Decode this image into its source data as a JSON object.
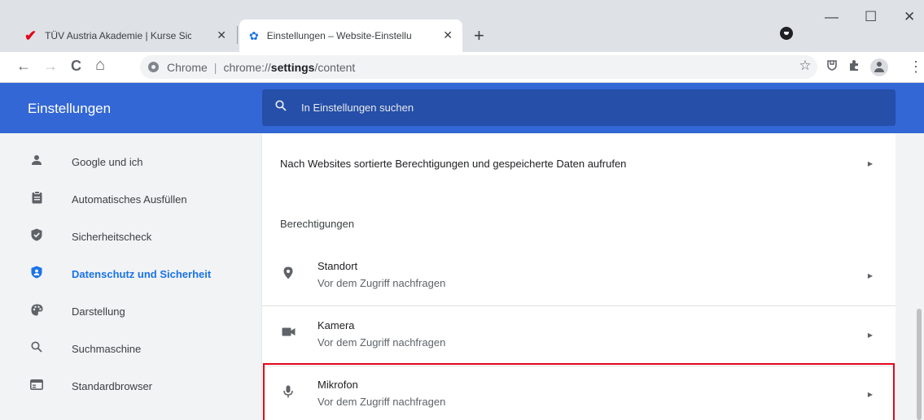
{
  "tabs": [
    {
      "title": "TÜV Austria Akademie | Kurse Sic",
      "favicon": "tuv-v-logo",
      "close": "✕"
    },
    {
      "title": "Einstellungen – Website-Einstellu",
      "favicon": "settings-gear-icon",
      "close": "✕"
    }
  ],
  "window_buttons": {
    "minimize": "—",
    "maximize": "☐",
    "close": "✕"
  },
  "toolbar": {
    "back": "←",
    "forward": "→",
    "reload": "C",
    "home": "⌂",
    "star": "☆",
    "menu": "⋮"
  },
  "omnibox": {
    "scheme_label": "Chrome",
    "separator": "|",
    "url_prefix": "chrome://",
    "url_host": "settings",
    "url_path": "/content"
  },
  "settings": {
    "title": "Einstellungen",
    "search_placeholder": "In Einstellungen suchen"
  },
  "sidebar": {
    "items": [
      {
        "label": "Google und ich",
        "icon": "person-icon"
      },
      {
        "label": "Automatisches Ausfüllen",
        "icon": "clipboard-icon"
      },
      {
        "label": "Sicherheitscheck",
        "icon": "shield-check-icon"
      },
      {
        "label": "Datenschutz und Sicherheit",
        "icon": "shield-icon",
        "active": true
      },
      {
        "label": "Darstellung",
        "icon": "palette-icon"
      },
      {
        "label": "Suchmaschine",
        "icon": "search-icon"
      },
      {
        "label": "Standardbrowser",
        "icon": "browser-icon"
      }
    ]
  },
  "content": {
    "site_data_link": "Nach Websites sortierte Berechtigungen und gespeicherte Daten aufrufen",
    "permissions_heading": "Berechtigungen",
    "permissions": [
      {
        "name": "Standort",
        "status": "Vor dem Zugriff nachfragen",
        "icon": "location-pin-icon"
      },
      {
        "name": "Kamera",
        "status": "Vor dem Zugriff nachfragen",
        "icon": "camera-icon"
      },
      {
        "name": "Mikrofon",
        "status": "Vor dem Zugriff nachfragen",
        "icon": "microphone-icon"
      }
    ]
  },
  "colors": {
    "header_blue": "#3367d6",
    "search_blue": "#254fa8",
    "active_link": "#1a73e8",
    "highlight_red": "#e3051b"
  }
}
